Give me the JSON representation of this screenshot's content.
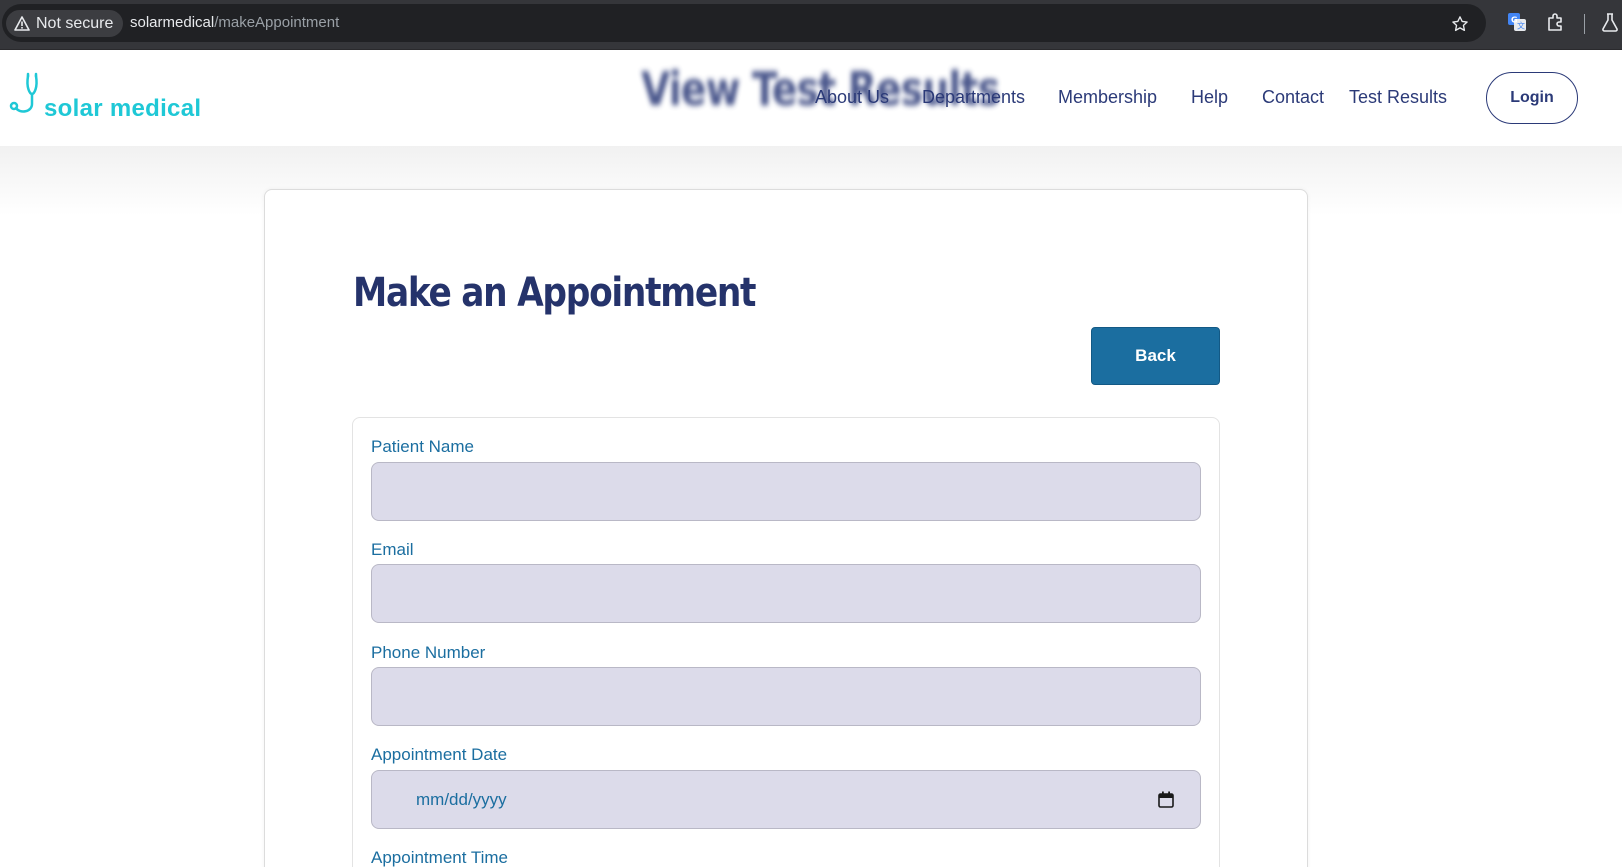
{
  "browser": {
    "security_label": "Not secure",
    "url_host": "solarmedical",
    "url_path": "/makeAppointment"
  },
  "header": {
    "logo_text": "solar medical",
    "ghost_heading": "View Test Results",
    "nav": [
      {
        "label": "About Us"
      },
      {
        "label": "Departments"
      },
      {
        "label": "Membership"
      },
      {
        "label": "Help"
      },
      {
        "label": "Contact"
      },
      {
        "label": "Test Results"
      }
    ],
    "login_label": "Login"
  },
  "page": {
    "title": "Make an Appointment",
    "back_label": "Back"
  },
  "form": {
    "fields": [
      {
        "label": "Patient Name",
        "value": ""
      },
      {
        "label": "Email",
        "value": ""
      },
      {
        "label": "Phone Number",
        "value": ""
      },
      {
        "label": "Appointment Date",
        "value": "mm/dd/yyyy"
      },
      {
        "label": "Appointment Time",
        "value": ""
      }
    ]
  },
  "colors": {
    "brand": "#1fc8d6",
    "nav_text": "#2b3a78",
    "title": "#25336b",
    "button": "#1b6ea0",
    "input_bg": "#dcdbea"
  }
}
